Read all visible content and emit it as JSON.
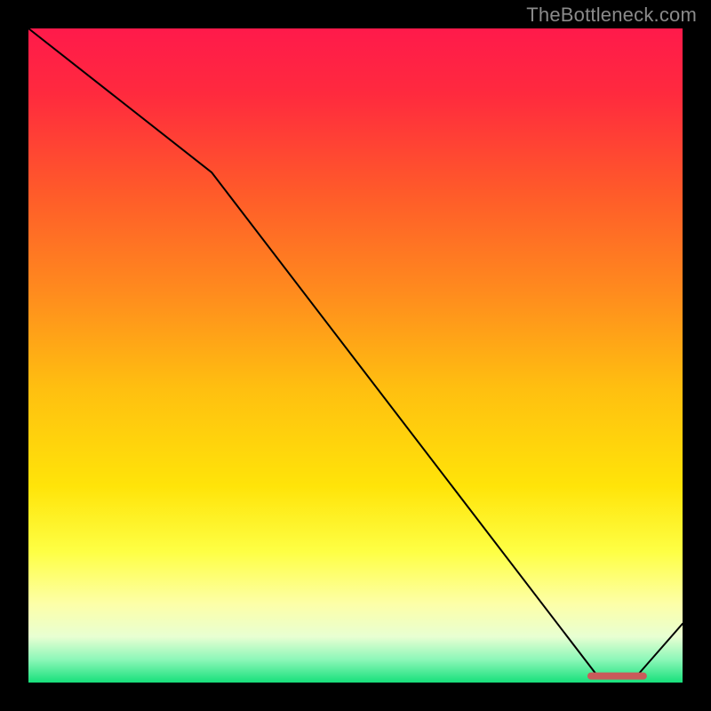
{
  "attribution": "TheBottleneck.com",
  "chart_data": {
    "type": "line",
    "title": "",
    "xlabel": "",
    "ylabel": "",
    "xlim": [
      0,
      100
    ],
    "ylim": [
      0,
      100
    ],
    "x": [
      0,
      28,
      87,
      93,
      100
    ],
    "values": [
      100,
      78,
      1,
      1,
      9
    ],
    "highlight_segment": {
      "x_start": 86,
      "x_end": 94,
      "y": 1
    },
    "gradient_stops": [
      {
        "pos": 0.0,
        "color": "#ff1a4b"
      },
      {
        "pos": 0.1,
        "color": "#ff2a3e"
      },
      {
        "pos": 0.25,
        "color": "#ff5a2a"
      },
      {
        "pos": 0.4,
        "color": "#ff8a1e"
      },
      {
        "pos": 0.55,
        "color": "#ffbf10"
      },
      {
        "pos": 0.7,
        "color": "#ffe409"
      },
      {
        "pos": 0.8,
        "color": "#feff44"
      },
      {
        "pos": 0.88,
        "color": "#fdffa8"
      },
      {
        "pos": 0.93,
        "color": "#e8ffd2"
      },
      {
        "pos": 0.965,
        "color": "#8cf7b8"
      },
      {
        "pos": 1.0,
        "color": "#17e07b"
      }
    ]
  }
}
